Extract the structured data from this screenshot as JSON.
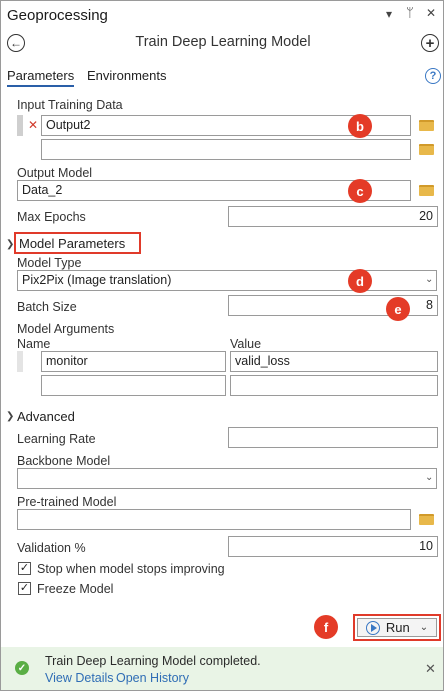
{
  "pane": {
    "title": "Geoprocessing",
    "controls": [
      "▾",
      "ᛘ",
      "✕"
    ]
  },
  "tool": {
    "title": "Train Deep Learning Model",
    "back_glyph": "←",
    "add_glyph": "+"
  },
  "tabs": {
    "parameters": "Parameters",
    "environments": "Environments",
    "help_glyph": "?"
  },
  "params": {
    "input_training_data": {
      "label": "Input Training Data",
      "rows": [
        "Output2",
        ""
      ],
      "remove_glyph": "✕"
    },
    "output_model": {
      "label": "Output Model",
      "value": "Data_2"
    },
    "max_epochs": {
      "label": "Max Epochs",
      "value": "20"
    }
  },
  "model_parameters": {
    "heading": "Model Parameters",
    "model_type": {
      "label": "Model Type",
      "value": "Pix2Pix (Image translation)"
    },
    "batch_size": {
      "label": "Batch Size",
      "value": "8"
    },
    "model_arguments": {
      "label": "Model Arguments",
      "col_name": "Name",
      "col_value": "Value",
      "rows": [
        {
          "name": "monitor",
          "value": "valid_loss"
        },
        {
          "name": "",
          "value": ""
        }
      ]
    }
  },
  "advanced": {
    "heading": "Advanced",
    "learning_rate": {
      "label": "Learning Rate",
      "value": ""
    },
    "backbone_model": {
      "label": "Backbone Model",
      "value": ""
    },
    "pretrained_model": {
      "label": "Pre-trained Model",
      "value": ""
    },
    "validation": {
      "label": "Validation %",
      "value": "10"
    },
    "stop_improving": {
      "label": "Stop when model stops improving",
      "checked": true
    },
    "freeze_model": {
      "label": "Freeze Model",
      "checked": true
    }
  },
  "run": {
    "label": "Run"
  },
  "markers": {
    "b": "b",
    "c": "c",
    "d": "d",
    "e": "e",
    "f": "f"
  },
  "status": {
    "message": "Train Deep Learning Model completed.",
    "view_details": "View Details",
    "open_history": "Open History"
  },
  "colors": {
    "accent": "#2a5fa8",
    "marker": "#e43b27",
    "status_bg": "#e9f4e6",
    "link": "#2f6db5"
  }
}
